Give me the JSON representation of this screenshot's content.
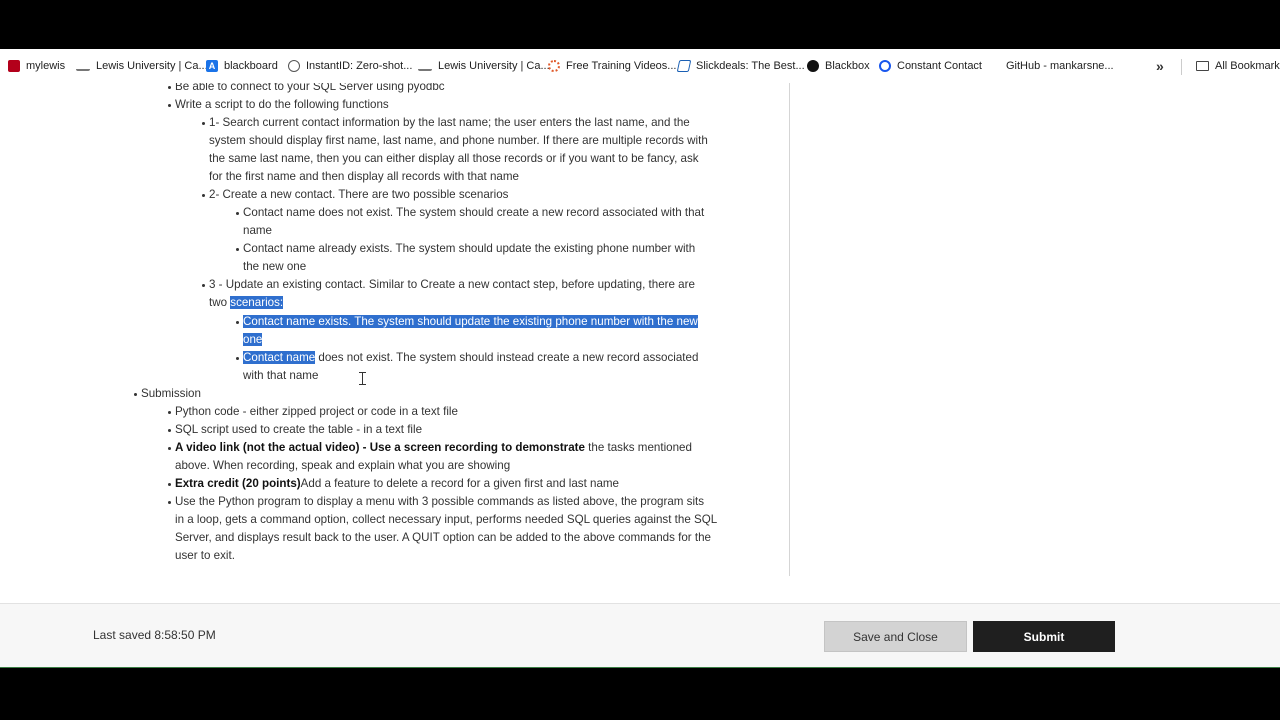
{
  "bookmarks": [
    {
      "label": "mylewis",
      "icon": "mylewis-icon",
      "color": "#b3001b"
    },
    {
      "label": "Lewis University | Ca...",
      "icon": "lewis-icon",
      "color": "#666666"
    },
    {
      "label": "blackboard",
      "icon": "blackboard-icon",
      "color": "#1a73e8"
    },
    {
      "label": "InstantID: Zero-shot...",
      "icon": "globe-icon",
      "color": "#555555"
    },
    {
      "label": "Lewis University | Ca...",
      "icon": "lewis-icon",
      "color": "#666666"
    },
    {
      "label": "Free Training Videos...",
      "icon": "gear-flower-icon",
      "color": "#e05a2b"
    },
    {
      "label": "Slickdeals: The Best...",
      "icon": "slickdeals-icon",
      "color": "#1a5fb4"
    },
    {
      "label": "Blackbox",
      "icon": "blackbox-icon",
      "color": "#111111"
    },
    {
      "label": "Constant Contact",
      "icon": "constant-contact-icon",
      "color": "#1856ed"
    },
    {
      "label": "GitHub - mankarsne...",
      "icon": "github-icon",
      "color": "#ffffff"
    }
  ],
  "more_bookmarks": "»",
  "all_bookmarks": "All Bookmarks",
  "doc": {
    "l1": "Be able to connect to your SQL Server using pyodbc",
    "l2": "Write a script to do the following functions",
    "s1a": "1- Search current contact information by the last name; the user enters the last name, and the",
    "s1b": "system should display first name, last name, and phone number. If there are multiple records with",
    "s1c": "the same last name, then you can either display all those records or if you want to be fancy, ask",
    "s1d": "for the first name and then display all records with that name",
    "s2": "2- Create a new contact. There are two possible scenarios",
    "s2a1": "Contact name does not exist. The system should create a new record associated with that",
    "s2a2": "name",
    "s2b1": "Contact name already exists. The system should update the existing phone number with",
    "s2b2": "the new one",
    "s3a": "3 - Update an existing contact. Similar to Create a new contact step, before updating, there are",
    "s3b_pre": "two ",
    "s3b_hl": "scenarios:",
    "s3a1": "Contact name exists. The system should update the existing phone number with the new",
    "s3a2": "one",
    "s3c_hl": "Contact name",
    "s3c_rest": " does not exist. The system should instead create a new record associated",
    "s3c2": "with that name",
    "submission": "Submission",
    "sub1": "Python code - either zipped project or code in a text file",
    "sub2": "SQL script used to create the table - in a text file",
    "sub3_bold": "A video link (not the actual video) - Use a screen recording to demonstrate",
    "sub3_rest": " the tasks mentioned",
    "sub3b": "above. When recording, speak and explain what you are showing",
    "sub4_bold": "Extra credit (20 points)",
    "sub4_rest": "Add a feature to delete a record for a given first and last name",
    "sub5a": "Use the Python program to display a menu with 3 possible commands as listed above, the program sits",
    "sub5b": "in a loop, gets a command option, collect necessary input, performs needed SQL queries against the SQL",
    "sub5c": "Server, and displays result back to the user. A QUIT option can be added to the above commands for the",
    "sub5d": "user to exit."
  },
  "footer": {
    "last_saved": "Last saved 8:58:50 PM",
    "save_close": "Save and Close",
    "submit": "Submit"
  }
}
